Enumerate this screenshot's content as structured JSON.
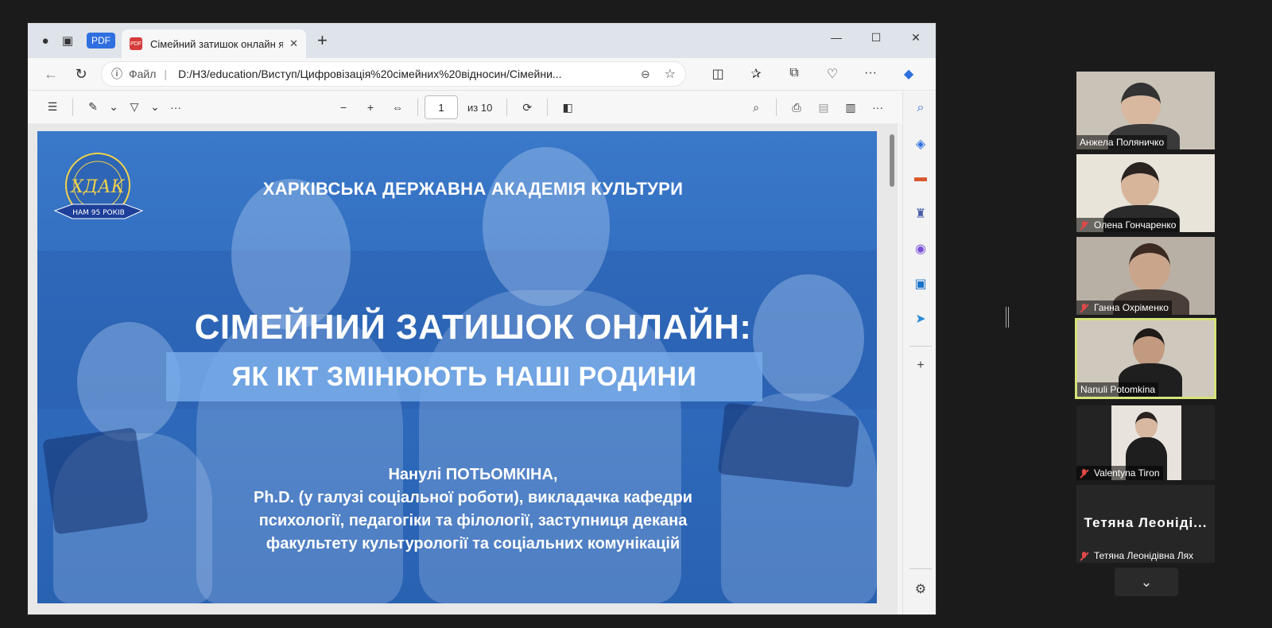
{
  "browser": {
    "pdf_pill": "PDF",
    "tab_title": "Сімейний затишок онлайн як ІК",
    "tab_favicon": "PDF",
    "new_tab": "+",
    "address": {
      "label": "Файл",
      "url": "D:/Н3/education/Виступ/Цифровізація%20сімейних%20відносин/Сімейни..."
    }
  },
  "pdf_toolbar": {
    "page_current": "1",
    "page_total_label": "из 10"
  },
  "slide": {
    "logo_text": "ХДАК",
    "logo_ribbon": "НАМ 95 РОКІВ",
    "logo_ring": "ХАРКІВСЬКА ДЕРЖАВНА АКАДЕМІЯ КУЛЬТУРИ",
    "org": "ХАРКІВСЬКА ДЕРЖАВНА АКАДЕМІЯ КУЛЬТУРИ",
    "title": "СІМЕЙНИЙ ЗАТИШОК ОНЛАЙН:",
    "subtitle": "ЯК ІКТ ЗМІНЮЮТЬ НАШІ РОДИНИ",
    "author_lines": [
      "Нанулі ПОТЬОМКІНА,",
      "Ph.D. (у галузі соціальної роботи), викладачка кафедри",
      "психології, педагогіки та філології, заступниця декана",
      "факультету культурології та соціальних комунікацій"
    ]
  },
  "participants": [
    {
      "name": "Анжела Поляничко",
      "muted": false
    },
    {
      "name": "Олена Гончаренко",
      "muted": true
    },
    {
      "name": "Ганна Охріменко",
      "muted": true
    },
    {
      "name": "Nanuli Potomkina",
      "muted": false,
      "active": true
    },
    {
      "name": "Valentyna Tiron",
      "muted": true
    },
    {
      "name": "Тетяна Леонідівна Лях",
      "muted": true,
      "display": "Тетяна Леоніді..."
    }
  ],
  "colors": {
    "slide_blue": "#2f6bbd",
    "active_border": "#d4e37a",
    "muted_red": "#e04848",
    "edge_accent": "#2f6fe0"
  }
}
